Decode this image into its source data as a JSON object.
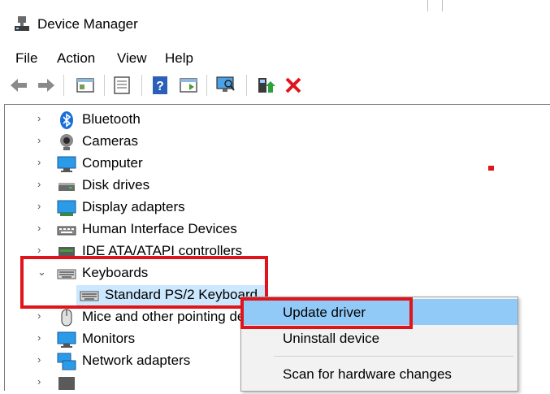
{
  "window": {
    "title": "Device Manager",
    "icon": "device-manager-icon"
  },
  "menu": [
    "File",
    "Action",
    "View",
    "Help"
  ],
  "toolbar": {
    "buttons": [
      "back-arrow-icon",
      "forward-arrow-icon",
      "properties-icon",
      "list-view-icon",
      "help-icon",
      "action-pane-icon",
      "scan-hardware-icon",
      "update-driver-icon",
      "uninstall-icon"
    ]
  },
  "tree": {
    "items": [
      {
        "label": "Bluetooth",
        "icon": "bluetooth-icon",
        "expanded": false
      },
      {
        "label": "Cameras",
        "icon": "camera-icon",
        "expanded": false
      },
      {
        "label": "Computer",
        "icon": "computer-icon",
        "expanded": false
      },
      {
        "label": "Disk drives",
        "icon": "disk-drive-icon",
        "expanded": false
      },
      {
        "label": "Display adapters",
        "icon": "display-adapter-icon",
        "expanded": false
      },
      {
        "label": "Human Interface Devices",
        "icon": "hid-icon",
        "expanded": false
      },
      {
        "label": "IDE ATA/ATAPI controllers",
        "icon": "ide-controller-icon",
        "expanded": false
      },
      {
        "label": "Keyboards",
        "icon": "keyboard-icon",
        "expanded": true
      },
      {
        "label": "Standard PS/2 Keyboard",
        "icon": "keyboard-icon",
        "child": true,
        "selected": true
      },
      {
        "label": "Mice and other pointing devices",
        "icon": "mouse-icon",
        "expanded": false
      },
      {
        "label": "Monitors",
        "icon": "monitor-icon",
        "expanded": false
      },
      {
        "label": "Network adapters",
        "icon": "network-adapter-icon",
        "expanded": false
      }
    ]
  },
  "context_menu": {
    "items": [
      "Update driver",
      "Uninstall device",
      "Scan for hardware changes"
    ],
    "highlighted": "Update driver"
  },
  "colors": {
    "highlight": "#91c9f7",
    "selection": "#cce8ff",
    "annotation": "#e0151b",
    "uninstall_x": "#e0151b"
  }
}
